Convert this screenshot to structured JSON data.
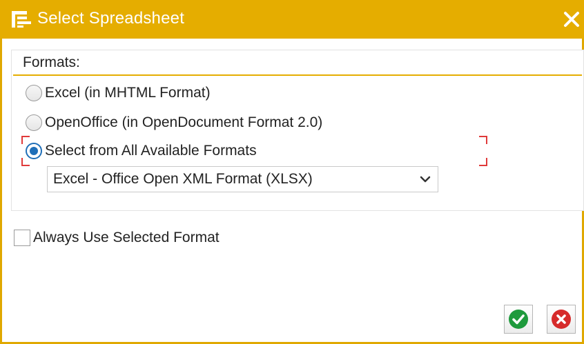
{
  "window": {
    "title": "Select Spreadsheet",
    "icon": "spreadsheet-window-icon",
    "close_icon": "close-icon"
  },
  "formats": {
    "group_title": "Formats:",
    "options": [
      {
        "label": "Excel (in MHTML Format)",
        "selected": false
      },
      {
        "label": "OpenOffice (in OpenDocument Format 2.0)",
        "selected": false
      },
      {
        "label": "Select from All Available Formats",
        "selected": true
      }
    ],
    "dropdown": {
      "value": "Excel - Office Open XML Format (XLSX)"
    }
  },
  "always_use": {
    "label": "Always Use Selected Format",
    "checked": false
  },
  "buttons": {
    "ok_icon": "checkmark-icon",
    "cancel_icon": "cancel-icon"
  },
  "colors": {
    "accent": "#e5ad00",
    "radio_selected": "#1f6fb8",
    "ok_green": "#1e9a3c",
    "cancel_red": "#d62b2b",
    "focus_marker": "#e03a3a"
  }
}
